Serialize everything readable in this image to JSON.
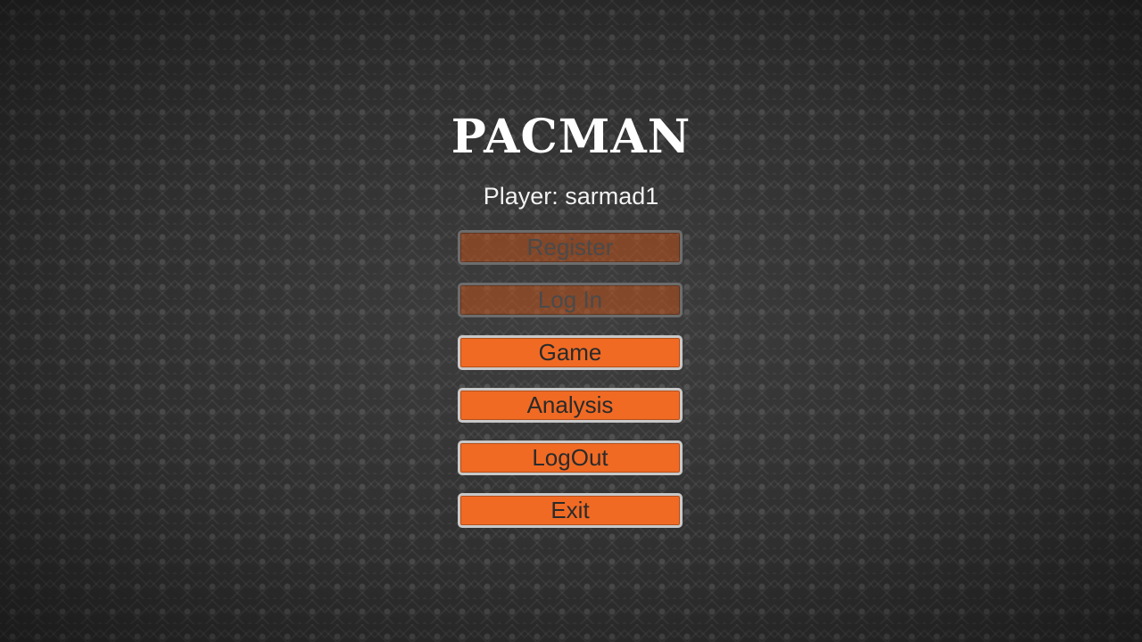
{
  "title": "PACMAN",
  "player_label": "Player: sarmad1",
  "buttons": {
    "register": "Register",
    "login": "Log In",
    "game": "Game",
    "analysis": "Analysis",
    "logout": "LogOut",
    "exit": "Exit"
  },
  "colors": {
    "button_active": "#f06a24",
    "button_disabled": "#a8501f",
    "title_text": "#ffffff",
    "background": "#2f2f2f"
  }
}
